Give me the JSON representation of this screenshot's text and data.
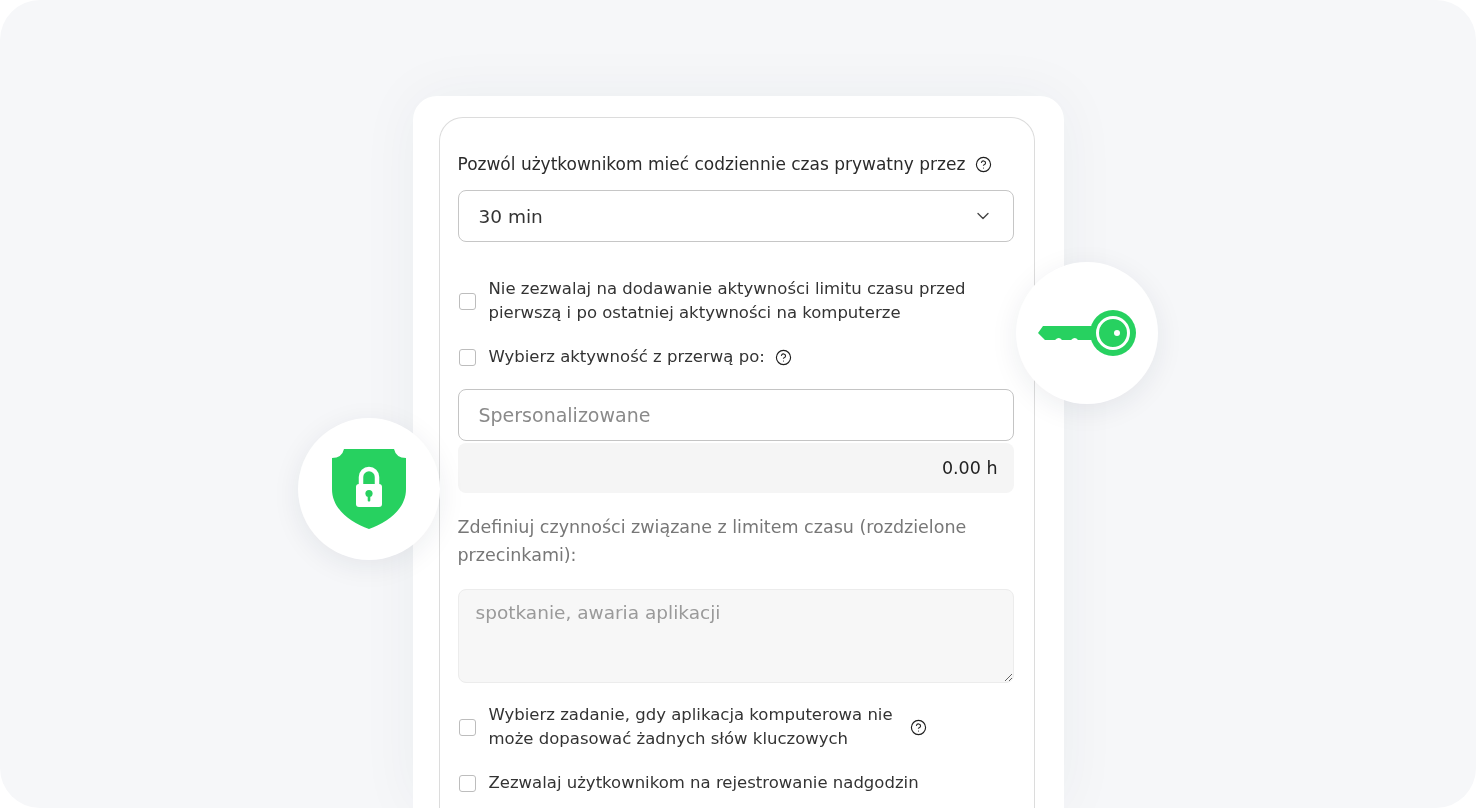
{
  "form": {
    "fields": [
      {
        "kind": "label",
        "text": "Pozwól użytkownikom mieć codziennie czas prywatny przez",
        "has_help": true
      },
      {
        "kind": "select",
        "value": "30 min"
      },
      {
        "kind": "checkbox",
        "label": "Nie zezwalaj na dodawanie aktywności limitu czasu przed pierwszą i po ostatniej aktywności na komputerze",
        "checked": false,
        "has_help": false
      },
      {
        "kind": "checkbox",
        "label": "Wybierz aktywność z przerwą po:",
        "checked": false,
        "has_help": true
      },
      {
        "kind": "input",
        "placeholder": "Spersonalizowane"
      },
      {
        "kind": "readout",
        "value": "0.00 h"
      },
      {
        "kind": "note",
        "text": "Zdefiniuj czynności związane z limitem czasu (rozdzielone przecinkami):"
      },
      {
        "kind": "textarea",
        "placeholder": "spotkanie, awaria aplikacji"
      },
      {
        "kind": "checkbox",
        "label": "Wybierz zadanie, gdy aplikacja komputerowa nie może dopasować żadnych słów kluczowych",
        "checked": false,
        "has_help": true
      },
      {
        "kind": "checkbox",
        "label": "Zezwalaj użytkownikom na rejestrowanie nadgodzin",
        "checked": false,
        "has_help": false
      }
    ]
  }
}
